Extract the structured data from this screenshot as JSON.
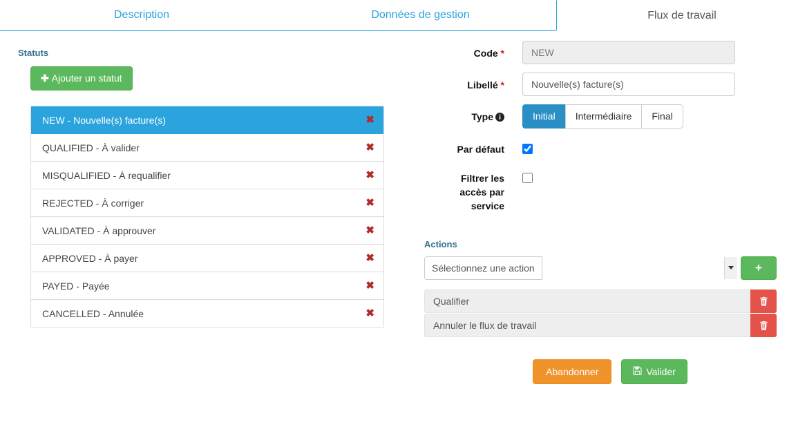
{
  "tabs": [
    {
      "label": "Description",
      "active": false
    },
    {
      "label": "Données de gestion",
      "active": false
    },
    {
      "label": "Flux de travail",
      "active": true
    }
  ],
  "statuses_panel": {
    "heading": "Statuts",
    "add_button_label": "Ajouter un statut",
    "add_button_icon": "plus-icon",
    "remove_icon": "close-x-icon",
    "items": [
      {
        "label": "NEW - Nouvelle(s) facture(s)",
        "selected": true
      },
      {
        "label": "QUALIFIED - À valider",
        "selected": false
      },
      {
        "label": "MISQUALIFIED - À requalifier",
        "selected": false
      },
      {
        "label": "REJECTED - À corriger",
        "selected": false
      },
      {
        "label": "VALIDATED - À approuver",
        "selected": false
      },
      {
        "label": "APPROVED - À payer",
        "selected": false
      },
      {
        "label": "PAYED - Payée",
        "selected": false
      },
      {
        "label": "CANCELLED - Annulée",
        "selected": false
      }
    ]
  },
  "form": {
    "code": {
      "label": "Code",
      "required_mark": "*",
      "value": "NEW",
      "disabled": true
    },
    "libelle": {
      "label": "Libellé",
      "required_mark": "*",
      "value": "Nouvelle(s) facture(s)"
    },
    "type": {
      "label": "Type",
      "info_icon": "info-circle-icon",
      "options": [
        {
          "label": "Initial",
          "selected": true
        },
        {
          "label": "Intermédiaire",
          "selected": false
        },
        {
          "label": "Final",
          "selected": false
        }
      ]
    },
    "par_defaut": {
      "label": "Par défaut",
      "checked": true
    },
    "filtrer_acces": {
      "label_line1": "Filtrer les",
      "label_line2": "accès par",
      "label_line3": "service",
      "checked": false
    }
  },
  "actions_panel": {
    "heading": "Actions",
    "select_value": "Sélectionnez une action",
    "add_button_icon": "plus-icon",
    "add_button_label": "+",
    "delete_icon": "trash-icon",
    "rows": [
      {
        "label": "Qualifier"
      },
      {
        "label": "Annuler le flux de travail"
      }
    ]
  },
  "footer": {
    "cancel_label": "Abandonner",
    "save_label": "Valider",
    "save_icon": "save-floppy-icon"
  },
  "colors": {
    "accent_blue": "#2ba3dd",
    "type_active_blue": "#2a8fc4",
    "heading_blue": "#31708f",
    "green": "#5cb85c",
    "orange": "#f0932b",
    "red": "#e4534a",
    "remove_x_red": "#b02b2b"
  }
}
